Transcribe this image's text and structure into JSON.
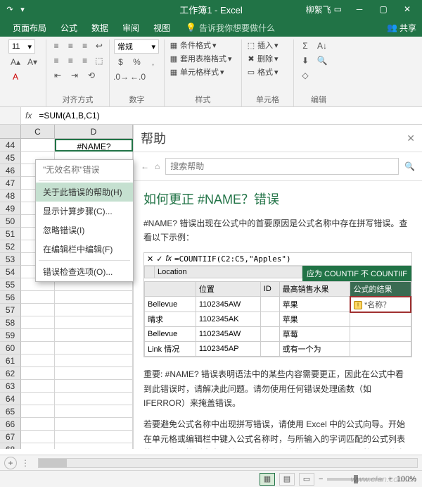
{
  "title": "工作簿1 - Excel",
  "user": "柳絮飞",
  "share": "共享",
  "tabs": {
    "t0": "页面布局",
    "t1": "公式",
    "t2": "数据",
    "t3": "审阅",
    "t4": "视图",
    "tell": "告诉我你想要做什么"
  },
  "ribbon": {
    "font_size": "11",
    "number_format": "常规",
    "cond": "条件格式",
    "table": "套用表格格式",
    "cellstyle": "单元格样式",
    "insert": "插入",
    "delete": "删除",
    "format": "格式",
    "g_align": "对齐方式",
    "g_number": "数字",
    "g_style": "样式",
    "g_cells": "单元格",
    "g_edit": "编辑"
  },
  "formula": "=SUM(A1,B,C1)",
  "sheet": {
    "col_c": "C",
    "col_d": "D",
    "row_label": "44",
    "cell_value": "#NAME?"
  },
  "ctx": {
    "header": "\"无效名称\"错误",
    "i1": "关于此错误的帮助(H)",
    "i2": "显示计算步骤(C)...",
    "i3": "忽略错误(I)",
    "i4": "在编辑栏中编辑(F)",
    "i5": "错误检查选项(O)..."
  },
  "help": {
    "title": "帮助",
    "search_ph": "搜索帮助",
    "h1": "如何更正 #NAME？错误",
    "p1": "#NAME? 错误出现在公式中的首要原因是公式名称中存在拼写错误。查看以下示例：",
    "example_formula": "=COUNTIIF(C2:C5,\"Apples\")",
    "banner": "应为 COUNTIF 不 COUNTIIF",
    "tbl": {
      "h_loc": "Location",
      "h_pos": "位置",
      "h_id": "ID",
      "h_fruit": "最高销售水果",
      "h_result": "公式的结果",
      "rows": [
        {
          "c1": "Bellevue",
          "c2": "1102345AW",
          "c3": "苹果",
          "c4": "*名称？"
        },
        {
          "c1": "晴求",
          "c2": "1102345AK",
          "c3": "苹果",
          "c4": ""
        },
        {
          "c1": "Bellevue",
          "c2": "1102345AW",
          "c3": "草莓",
          "c4": ""
        },
        {
          "c1": "Link 情况",
          "c2": "1102345AP",
          "c3": "或有一个为",
          "c4": ""
        }
      ]
    },
    "p2": "重要: #NAME? 错误表明语法中的某些内容需要更正，因此在公式中看到此错误时，请解决此问题。请勿使用任何错误处理函数（如 IFERROR）来掩盖错误。",
    "p3": "若要避免公式名称中出现拼写错误，请使用 Excel 中的公式向导。开始在单元格或编辑栏中键入公式名称时，与所输入的字词匹配的公式列表将显示在下拉列表中。输入公式名称和左括号后，公式向导将以悬停文本的形式显示语法。"
  },
  "status": {
    "zoom": "100%"
  },
  "watermark": "www.cfan.com.cn"
}
